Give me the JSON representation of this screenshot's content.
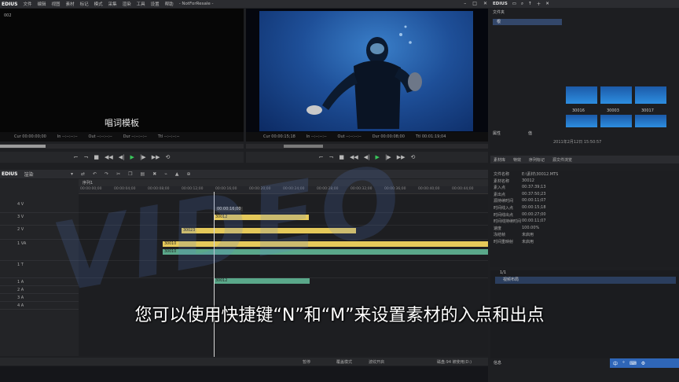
{
  "app": {
    "name": "EDIUS",
    "menu": [
      "文件",
      "编辑",
      "视图",
      "素材",
      "标记",
      "模式",
      "采集",
      "渲染",
      "工具",
      "设置",
      "帮助"
    ],
    "project_path": "- NotForResale -"
  },
  "player_left": {
    "clip_code": "002",
    "lyric_text": "唱词模板",
    "timecodes": [
      "Cur 00:00:00;00",
      "In --:--:--:--",
      "Out --:--:--:--",
      "Dur --:--:--:--",
      "Ttl --:--:--:--"
    ]
  },
  "player_right": {
    "timecodes": [
      "Cur 00:00:15;18",
      "In --:--:--:--",
      "Out --:--:--:--",
      "Dur 00:00:08;00",
      "Ttl 00:01:19;04"
    ]
  },
  "bin": {
    "folder_label": "文件夹",
    "tree_root": "根",
    "thumbnails": [
      {
        "label": "30016"
      },
      {
        "label": "30003"
      },
      {
        "label": "30017"
      }
    ],
    "tabs": [
      "属性",
      "值"
    ],
    "date_label": "2011年2月12日 15:50:57"
  },
  "properties_panel": {
    "tabs": [
      "素材库",
      "特效",
      "序列标记",
      "源文件浏览"
    ],
    "rows": [
      {
        "key": "文件名称",
        "value": "E:\\素材\\30012.MTS"
      },
      {
        "key": "素材名称",
        "value": "30012"
      },
      {
        "key": "素入点",
        "value": "00:37:39;13"
      },
      {
        "key": "素出点",
        "value": "00:37:50;23"
      },
      {
        "key": "源持续时间",
        "value": "00:00:11;07"
      },
      {
        "key": "时间线入点",
        "value": "00:00:15;18"
      },
      {
        "key": "时间线出点",
        "value": "00:00:27;00"
      },
      {
        "key": "时间线持续时间",
        "value": "00:00:11;07"
      },
      {
        "key": "速度",
        "value": "100.00%"
      },
      {
        "key": "冻结帧",
        "value": "未启用"
      },
      {
        "key": "时间重映射",
        "value": "未启用"
      }
    ],
    "effect_label": "视频布局",
    "page": "1/1",
    "info_label": "信息"
  },
  "timeline": {
    "title": "渲染",
    "tab_label": "序列1",
    "ruler_ticks": [
      "00:00:00;00",
      "00:00:04;00",
      "00:00:08;00",
      "00:00:12;00",
      "00:00:16;00",
      "00:00:20;00",
      "00:00:24;00",
      "00:00:28;00",
      "00:00:32;00",
      "00:00:36;00",
      "00:00:40;00",
      "00:00:44;00"
    ],
    "playhead_tc": "00:00:16;00",
    "tracks": [
      "4 V",
      "3 V",
      "2 V",
      "1 VA",
      "1 T",
      "1 A",
      "2 A",
      "3 A",
      "4 A"
    ],
    "clips": [
      {
        "track": "3 V",
        "label": "30012",
        "color": "#e5c95a"
      },
      {
        "track": "2 V",
        "label": "30023",
        "color": "#e5c95a"
      },
      {
        "track": "1 VA",
        "label": "30010",
        "color": "#e5c95a"
      },
      {
        "track": "1 VA audio",
        "label": "30010",
        "color": "#5aa88a"
      },
      {
        "track": "1 A",
        "label": "30012",
        "color": "#5aa88a"
      }
    ],
    "status": [
      "暂停",
      "覆盖模式",
      "波纹开启",
      "磁盘:94 被使用(D:)"
    ]
  },
  "subtitle": "您可以使用快捷键“N”和“M”来设置素材的入点和出点",
  "tray": {
    "ime": "中"
  }
}
